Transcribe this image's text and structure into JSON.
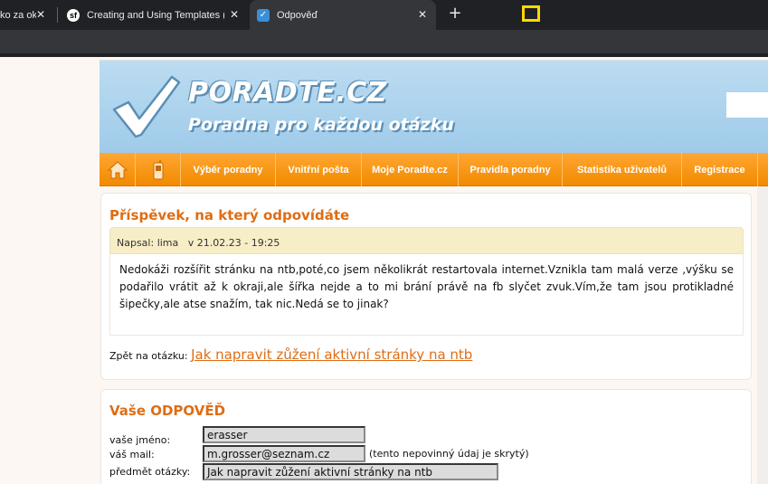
{
  "browser": {
    "tabs": [
      {
        "title": "ko za ok",
        "active": false
      },
      {
        "title": "Creating and Using Templates (Sy",
        "active": false
      },
      {
        "title": "Odpověď",
        "active": true
      }
    ],
    "new_tab": "+"
  },
  "site": {
    "logo_title": "PORADTE.CZ",
    "logo_subtitle": "Poradna pro každou otázku"
  },
  "nav": {
    "items": [
      "Výběr poradny",
      "Vnitřní pošta",
      "Moje Poradte.cz",
      "Pravidla poradny",
      "Statistika uživatelů",
      "Registrace"
    ]
  },
  "post": {
    "heading": "Příspěvek, na který odpovídáte",
    "author_label": "Napsal:",
    "author": "lima",
    "date": "v 21.02.23 - 19:25",
    "body": "Nedokáži rozšířit stránku na ntb,poté,co jsem několikrát restartovala internet.Vznikla tam malá verze ,výšku se podařilo vrátit až k okraji,ale šířka nejde a to mi brání právě na fb slyčet zvuk.Vím,že tam jsou protikladné šipečky,ale atse snažím, tak nic.Nedá se to jinak?",
    "back_label": "Zpět na otázku:",
    "back_link": "Jak napravit zůžení aktivní stránky na ntb"
  },
  "answer": {
    "heading": "Vaše ODPOVĚĎ",
    "name_label": "vaše jméno:",
    "name_value": "erasser",
    "mail_label": "váš mail:",
    "mail_value": "m.grosser@seznam.cz",
    "mail_note": "(tento nepovinný údaj je skrytý)",
    "subject_label": "předmět otázky:",
    "subject_value": "Jak napravit zůžení aktivní stránky na ntb"
  },
  "colors": {
    "accent": "#df6d14",
    "nav": "#f18a00",
    "header": "#9fcbea"
  }
}
